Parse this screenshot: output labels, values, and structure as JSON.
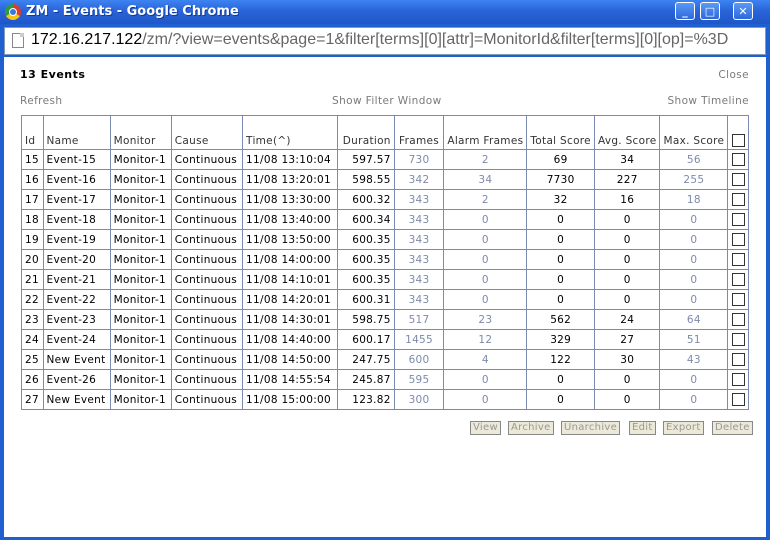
{
  "window": {
    "title": "ZM - Events - Google Chrome",
    "minimize": "_",
    "maximize": "□",
    "close": "✕"
  },
  "url": {
    "host": "172.16.217.122",
    "path": "/zm/?view=events&page=1&filter[terms][0][attr]=MonitorId&filter[terms][0][op]=%3D"
  },
  "header": {
    "events_count": "13 Events",
    "close": "Close",
    "refresh": "Refresh",
    "filter": "Show Filter Window",
    "timeline": "Show Timeline"
  },
  "table": {
    "headers": [
      "Id",
      "Name",
      "Monitor",
      "Cause",
      "Time(^)",
      "Duration",
      "Frames",
      "Alarm Frames",
      "Total Score",
      "Avg. Score",
      "Max. Score"
    ],
    "rows": [
      {
        "id": "15",
        "name": "Event-15",
        "monitor": "Monitor-1",
        "cause": "Continuous",
        "time": "11/08 13:10:04",
        "duration": "597.57",
        "frames": "730",
        "alarm": "2",
        "total": "69",
        "avg": "34",
        "max": "56"
      },
      {
        "id": "16",
        "name": "Event-16",
        "monitor": "Monitor-1",
        "cause": "Continuous",
        "time": "11/08 13:20:01",
        "duration": "598.55",
        "frames": "342",
        "alarm": "34",
        "total": "7730",
        "avg": "227",
        "max": "255"
      },
      {
        "id": "17",
        "name": "Event-17",
        "monitor": "Monitor-1",
        "cause": "Continuous",
        "time": "11/08 13:30:00",
        "duration": "600.32",
        "frames": "343",
        "alarm": "2",
        "total": "32",
        "avg": "16",
        "max": "18"
      },
      {
        "id": "18",
        "name": "Event-18",
        "monitor": "Monitor-1",
        "cause": "Continuous",
        "time": "11/08 13:40:00",
        "duration": "600.34",
        "frames": "343",
        "alarm": "0",
        "total": "0",
        "avg": "0",
        "max": "0"
      },
      {
        "id": "19",
        "name": "Event-19",
        "monitor": "Monitor-1",
        "cause": "Continuous",
        "time": "11/08 13:50:00",
        "duration": "600.35",
        "frames": "343",
        "alarm": "0",
        "total": "0",
        "avg": "0",
        "max": "0"
      },
      {
        "id": "20",
        "name": "Event-20",
        "monitor": "Monitor-1",
        "cause": "Continuous",
        "time": "11/08 14:00:00",
        "duration": "600.35",
        "frames": "343",
        "alarm": "0",
        "total": "0",
        "avg": "0",
        "max": "0"
      },
      {
        "id": "21",
        "name": "Event-21",
        "monitor": "Monitor-1",
        "cause": "Continuous",
        "time": "11/08 14:10:01",
        "duration": "600.35",
        "frames": "343",
        "alarm": "0",
        "total": "0",
        "avg": "0",
        "max": "0"
      },
      {
        "id": "22",
        "name": "Event-22",
        "monitor": "Monitor-1",
        "cause": "Continuous",
        "time": "11/08 14:20:01",
        "duration": "600.31",
        "frames": "343",
        "alarm": "0",
        "total": "0",
        "avg": "0",
        "max": "0"
      },
      {
        "id": "23",
        "name": "Event-23",
        "monitor": "Monitor-1",
        "cause": "Continuous",
        "time": "11/08 14:30:01",
        "duration": "598.75",
        "frames": "517",
        "alarm": "23",
        "total": "562",
        "avg": "24",
        "max": "64"
      },
      {
        "id": "24",
        "name": "Event-24",
        "monitor": "Monitor-1",
        "cause": "Continuous",
        "time": "11/08 14:40:00",
        "duration": "600.17",
        "frames": "1455",
        "alarm": "12",
        "total": "329",
        "avg": "27",
        "max": "51"
      },
      {
        "id": "25",
        "name": "New Event",
        "monitor": "Monitor-1",
        "cause": "Continuous",
        "time": "11/08 14:50:00",
        "duration": "247.75",
        "frames": "600",
        "alarm": "4",
        "total": "122",
        "avg": "30",
        "max": "43"
      },
      {
        "id": "26",
        "name": "Event-26",
        "monitor": "Monitor-1",
        "cause": "Continuous",
        "time": "11/08 14:55:54",
        "duration": "245.87",
        "frames": "595",
        "alarm": "0",
        "total": "0",
        "avg": "0",
        "max": "0"
      },
      {
        "id": "27",
        "name": "New Event",
        "monitor": "Monitor-1",
        "cause": "Continuous",
        "time": "11/08 15:00:00",
        "duration": "123.82",
        "frames": "300",
        "alarm": "0",
        "total": "0",
        "avg": "0",
        "max": "0"
      }
    ]
  },
  "actions": {
    "view": "View",
    "archive": "Archive",
    "unarchive": "Unarchive",
    "edit": "Edit",
    "export": "Export",
    "delete": "Delete"
  }
}
